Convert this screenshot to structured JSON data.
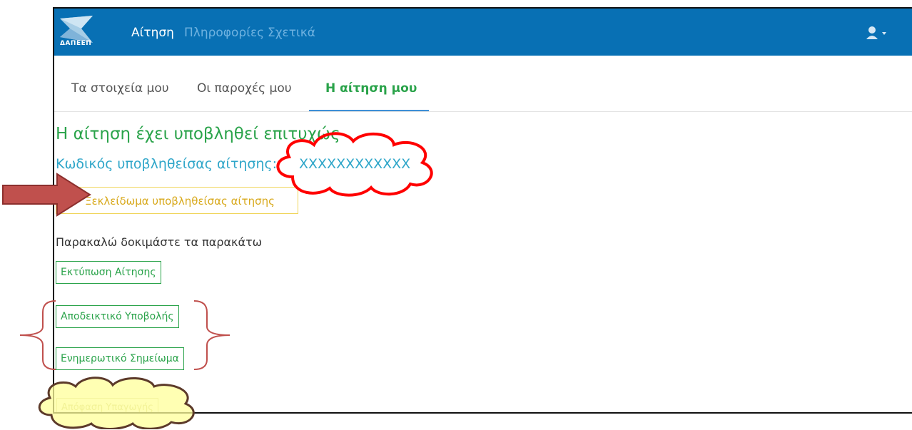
{
  "navbar": {
    "logo_text": "ΔΑΠΕΕΠ",
    "links": [
      {
        "label": "Αίτηση",
        "active": true
      },
      {
        "label": "Πληροφορίες",
        "active": false
      },
      {
        "label": "Σχετικά",
        "active": false
      }
    ],
    "user_icon": "user-icon",
    "dropdown_icon": "caret-down-icon"
  },
  "tabs": [
    {
      "label": "Τα στοιχεία μου",
      "active": false
    },
    {
      "label": "Οι παροχές μου",
      "active": false
    },
    {
      "label": "Η αίτηση μου",
      "active": true
    }
  ],
  "main": {
    "success_title": "Η αίτηση έχει υποβληθεί επιτυχώς",
    "code_label": "Κωδικός υποβληθείσας αίτησης:",
    "code_value": "XXXXXXXXXXXX",
    "unlock_button": "Ξεκλείδωμα υποβληθείσας αίτησης",
    "helper_text": "Παρακαλώ δοκιμάστε τα παρακάτω",
    "buttons": [
      {
        "label": "Εκτύπωση Αίτησης"
      },
      {
        "label": "Αποδεικτικό Υποβολής"
      },
      {
        "label": "Ενημερωτικό Σημείωμα"
      }
    ],
    "disabled_button": "Απόφαση Υπαγωγής"
  },
  "colors": {
    "navbar": "#0870b4",
    "success": "#2aa34a",
    "code": "#2fa6c9",
    "warning": "#d8a91c",
    "annotation_arrow": "#c0504d",
    "annotation_cloud_stroke": "#ff0000",
    "annotation_cloud_fill_yellow": "#ffff99"
  }
}
